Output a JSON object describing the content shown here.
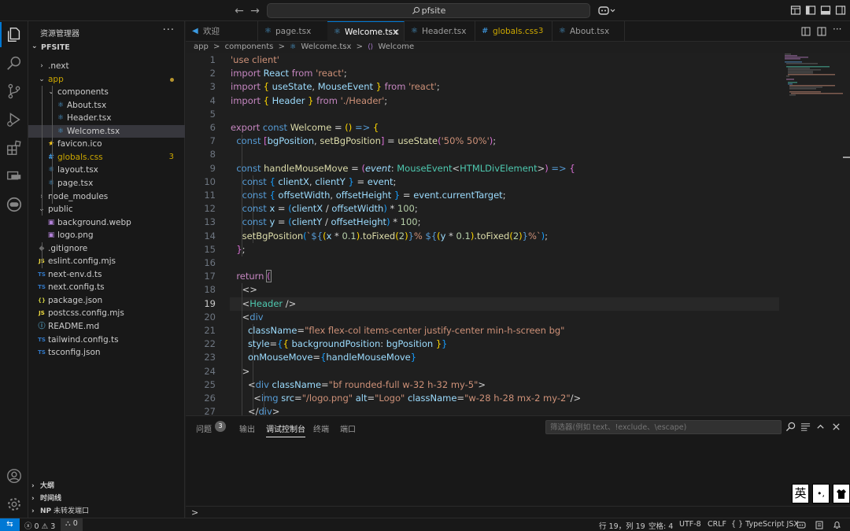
{
  "titlebar": {
    "back_icon": "arrow-left-icon",
    "forward_icon": "arrow-right-icon",
    "search_text": "pfsite",
    "copilot_icon": "copilot-icon"
  },
  "sidebar": {
    "title": "资源管理器",
    "more": "···",
    "root": "PFSITE",
    "items": [
      {
        "label": ".next",
        "kind": "folder",
        "open": false,
        "depth": 0
      },
      {
        "label": "app",
        "kind": "folder",
        "open": true,
        "depth": 0,
        "color": "#cca700",
        "dot": true
      },
      {
        "label": "components",
        "kind": "folder",
        "open": true,
        "depth": 1
      },
      {
        "label": "About.tsx",
        "kind": "react",
        "depth": 2
      },
      {
        "label": "Header.tsx",
        "kind": "react",
        "depth": 2
      },
      {
        "label": "Welcome.tsx",
        "kind": "react",
        "depth": 2,
        "selected": true
      },
      {
        "label": "favicon.ico",
        "kind": "star",
        "depth": 1
      },
      {
        "label": "globals.css",
        "kind": "css",
        "depth": 1,
        "color": "#cca700",
        "badge": "3"
      },
      {
        "label": "layout.tsx",
        "kind": "react",
        "depth": 1
      },
      {
        "label": "page.tsx",
        "kind": "react",
        "depth": 1
      },
      {
        "label": "node_modules",
        "kind": "folder",
        "open": false,
        "depth": 0
      },
      {
        "label": "public",
        "kind": "folder",
        "open": true,
        "depth": 0
      },
      {
        "label": "background.webp",
        "kind": "image",
        "depth": 1
      },
      {
        "label": "logo.png",
        "kind": "image",
        "depth": 1
      },
      {
        "label": ".gitignore",
        "kind": "git",
        "depth": 0
      },
      {
        "label": "eslint.config.mjs",
        "kind": "js",
        "depth": 0
      },
      {
        "label": "next-env.d.ts",
        "kind": "ts",
        "depth": 0
      },
      {
        "label": "next.config.ts",
        "kind": "ts",
        "depth": 0
      },
      {
        "label": "package.json",
        "kind": "json",
        "depth": 0
      },
      {
        "label": "postcss.config.mjs",
        "kind": "js",
        "depth": 0
      },
      {
        "label": "README.md",
        "kind": "info",
        "depth": 0
      },
      {
        "label": "tailwind.config.ts",
        "kind": "ts",
        "depth": 0
      },
      {
        "label": "tsconfig.json",
        "kind": "tsjson",
        "depth": 0
      }
    ],
    "outline": [
      "大纲",
      "时间线",
      "NP"
    ],
    "np_suffix": "未转发端口"
  },
  "tabs": [
    {
      "label": "欢迎",
      "icon": "vscode-icon",
      "active": false
    },
    {
      "label": "page.tsx",
      "icon": "react-icon",
      "active": false
    },
    {
      "label": "Welcome.tsx",
      "icon": "react-icon",
      "active": true,
      "close": "✕"
    },
    {
      "label": "Header.tsx",
      "icon": "react-icon",
      "active": false
    },
    {
      "label": "globals.css",
      "icon": "css-icon",
      "active": false,
      "count": "3"
    },
    {
      "label": "About.tsx",
      "icon": "react-icon",
      "active": false
    }
  ],
  "breadcrumb": [
    "app",
    ">",
    "components",
    ">",
    "Welcome.tsx",
    ">",
    "Welcome"
  ],
  "editor": {
    "current_line": 19,
    "line_numbers": [
      "1",
      "2",
      "3",
      "4",
      "5",
      "6",
      "7",
      "8",
      "9",
      "10",
      "11",
      "12",
      "13",
      "14",
      "15",
      "16",
      "17",
      "18",
      "19",
      "20",
      "21",
      "22",
      "23",
      "24",
      "25",
      "26",
      "27"
    ]
  },
  "panel": {
    "tabs": [
      "问题",
      "输出",
      "调试控制台",
      "终端",
      "端口"
    ],
    "problems_count": "3",
    "active_tab": "调试控制台",
    "filter_placeholder": "筛选器(例如 text、!exclude、\\escape)",
    "prompt": ">"
  },
  "ime": [
    "英",
    "•,",
    "👕"
  ],
  "statusbar": {
    "remote": "⇆",
    "errors": "0",
    "warnings": "3",
    "ports": "0",
    "position": "行 19，列 19",
    "spaces": "空格: 4",
    "encoding": "UTF-8",
    "eol": "CRLF",
    "language": "TypeScript JSX",
    "language_prefix": "{ }"
  }
}
